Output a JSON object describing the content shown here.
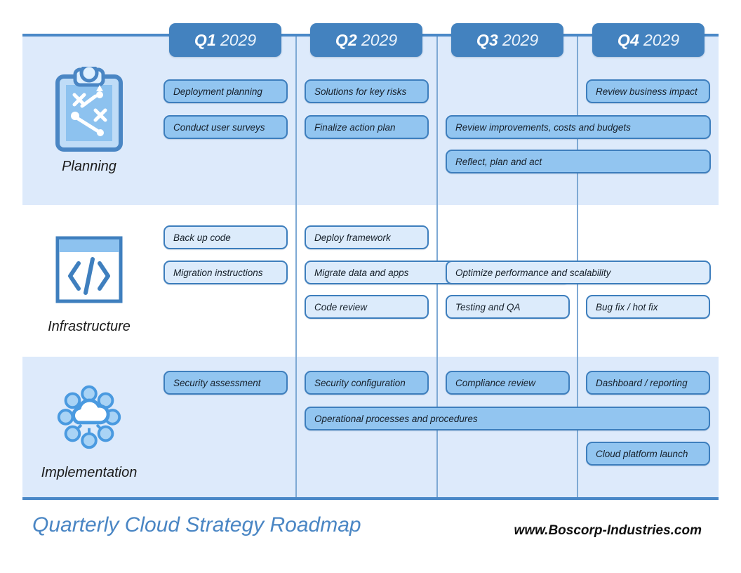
{
  "theme": {
    "rule_color": "#4a88c7",
    "band_fill": "#ddeafb",
    "band_alt_fill": "#ffffff",
    "chip_fill": "#4382bf",
    "chip_text": "#ffffff",
    "card_fill": "#92c5f0",
    "card_fill_light": "#dcebfb",
    "card_border": "#3d7ebd",
    "separator": "#7ea9d4",
    "title_color": "#4a86c4"
  },
  "quarters": [
    {
      "q": "Q1",
      "year": "2029"
    },
    {
      "q": "Q2",
      "year": "2029"
    },
    {
      "q": "Q3",
      "year": "2029"
    },
    {
      "q": "Q4",
      "year": "2029"
    }
  ],
  "rows": [
    {
      "label": "Planning",
      "icon": "clipboard-strategy-icon",
      "cards": [
        {
          "text": "Deployment planning",
          "col": 1,
          "span": 1,
          "line": 1
        },
        {
          "text": "Solutions for key risks",
          "col": 2,
          "span": 1,
          "line": 1
        },
        {
          "text": "Review business impact",
          "col": 4,
          "span": 1,
          "line": 1
        },
        {
          "text": "Conduct user surveys",
          "col": 1,
          "span": 1,
          "line": 2
        },
        {
          "text": "Finalize action plan",
          "col": 2,
          "span": 1,
          "line": 2
        },
        {
          "text": "Review improvements, costs and budgets",
          "col": 3,
          "span": 2,
          "line": 2
        },
        {
          "text": "Reflect, plan and act",
          "col": 3,
          "span": 2,
          "line": 3
        }
      ]
    },
    {
      "label": "Infrastructure",
      "icon": "code-window-icon",
      "cards": [
        {
          "text": "Back up code",
          "col": 1,
          "span": 1,
          "line": 1
        },
        {
          "text": "Deploy framework",
          "col": 2,
          "span": 1,
          "line": 1
        },
        {
          "text": "Migration instructions",
          "col": 1,
          "span": 1,
          "line": 2
        },
        {
          "text": "Migrate data and apps",
          "col": 2,
          "span": 2,
          "line": 2
        },
        {
          "text": "Optimize performance and scalability",
          "col": 3,
          "span": 2,
          "line": 2
        },
        {
          "text": "Code review",
          "col": 2,
          "span": 1,
          "line": 3
        },
        {
          "text": "Testing and QA",
          "col": 3,
          "span": 1,
          "line": 3
        },
        {
          "text": "Bug fix / hot fix",
          "col": 4,
          "span": 1,
          "line": 3
        }
      ]
    },
    {
      "label": "Implementation",
      "icon": "cloud-network-icon",
      "cards": [
        {
          "text": "Security assessment",
          "col": 1,
          "span": 1,
          "line": 1
        },
        {
          "text": "Security configuration",
          "col": 2,
          "span": 1,
          "line": 1
        },
        {
          "text": "Compliance review",
          "col": 3,
          "span": 1,
          "line": 1
        },
        {
          "text": "Dashboard / reporting",
          "col": 4,
          "span": 1,
          "line": 1
        },
        {
          "text": "Operational processes and procedures",
          "col": 2,
          "span": 3,
          "line": 2
        },
        {
          "text": "Cloud platform launch",
          "col": 4,
          "span": 1,
          "line": 3
        }
      ]
    }
  ],
  "footer": {
    "title": "Quarterly Cloud Strategy Roadmap",
    "website": "www.Boscorp-Industries.com"
  }
}
